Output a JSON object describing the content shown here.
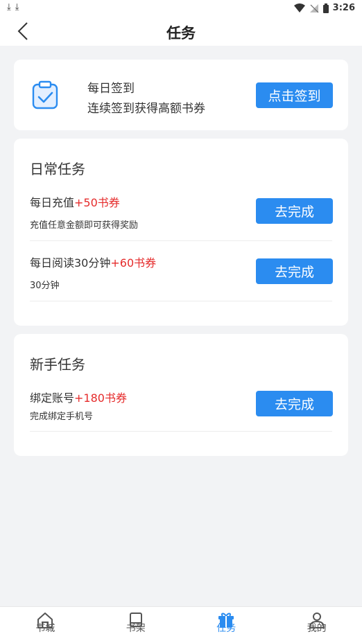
{
  "status_bar": {
    "time": "3:26"
  },
  "header": {
    "title": "任务"
  },
  "signin": {
    "title": "每日签到",
    "subtitle": "连续签到获得高额书券",
    "button_label": "点击签到"
  },
  "daily": {
    "section_title": "日常任务",
    "tasks": [
      {
        "name": "每日充值",
        "reward": "+50书券",
        "desc": "充值任意金额即可获得奖励",
        "button_label": "去完成"
      },
      {
        "name": "每日阅读30分钟",
        "reward": "+60书券",
        "desc": "30分钟",
        "button_label": "去完成"
      }
    ]
  },
  "newbie": {
    "section_title": "新手任务",
    "tasks": [
      {
        "name": "绑定账号",
        "reward": "+180书券",
        "desc": "完成绑定手机号",
        "button_label": "去完成"
      }
    ]
  },
  "tabs": [
    {
      "label": "书城",
      "icon": "home-icon"
    },
    {
      "label": "书架",
      "icon": "bookshelf-icon"
    },
    {
      "label": "任务",
      "icon": "gift-icon",
      "active": true
    },
    {
      "label": "我的",
      "icon": "user-icon"
    }
  ],
  "colors": {
    "accent": "#2b8cf0",
    "reward": "#e52b2b",
    "background": "#f2f3f5"
  }
}
